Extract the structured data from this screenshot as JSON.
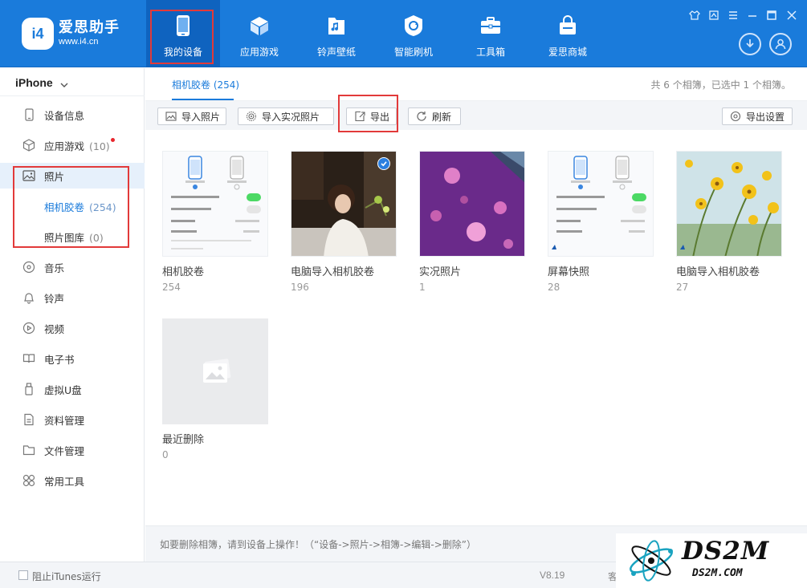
{
  "app": {
    "name": "爱思助手",
    "url": "www.i4.cn",
    "logo_text": "i4"
  },
  "nav": [
    {
      "label": "我的设备",
      "icon": "phone-icon"
    },
    {
      "label": "应用游戏",
      "icon": "cube-icon"
    },
    {
      "label": "铃声壁纸",
      "icon": "music-file-icon"
    },
    {
      "label": "智能刷机",
      "icon": "refresh-shield-icon"
    },
    {
      "label": "工具箱",
      "icon": "toolbox-icon"
    },
    {
      "label": "爱思商城",
      "icon": "shopping-bag-icon"
    }
  ],
  "window_controls": [
    "shirt-icon",
    "skin-icon",
    "menu-icon",
    "minimize-icon",
    "maximize-icon",
    "close-icon"
  ],
  "sidebar": {
    "device": "iPhone",
    "items": [
      {
        "label": "设备信息",
        "icon": "device-info-icon"
      },
      {
        "label": "应用游戏",
        "count": "(10)",
        "icon": "apps-icon"
      },
      {
        "label": "照片",
        "icon": "photo-icon"
      },
      {
        "label": "相机胶卷",
        "count": "(254)"
      },
      {
        "label": "照片图库",
        "count": "(0)"
      },
      {
        "label": "音乐",
        "icon": "music-icon"
      },
      {
        "label": "铃声",
        "icon": "bell-icon"
      },
      {
        "label": "视频",
        "icon": "video-icon"
      },
      {
        "label": "电子书",
        "icon": "ebook-icon"
      },
      {
        "label": "虚拟U盘",
        "icon": "usb-icon"
      },
      {
        "label": "资料管理",
        "icon": "data-icon"
      },
      {
        "label": "文件管理",
        "icon": "folder-icon"
      },
      {
        "label": "常用工具",
        "icon": "tools-icon"
      }
    ]
  },
  "tab": {
    "label": "相机胶卷 (254)"
  },
  "summary": "共 6 个相簿，已选中 1 个相簿。",
  "toolbar": {
    "import_photos": "导入照片",
    "import_live": "导入实况照片",
    "export": "导出",
    "refresh": "刷新",
    "export_settings": "导出设置"
  },
  "albums": [
    {
      "name": "相机胶卷",
      "count": "254"
    },
    {
      "name": "电脑导入相机胶卷",
      "count": "196",
      "selected": true
    },
    {
      "name": "实况照片",
      "count": "1"
    },
    {
      "name": "屏幕快照",
      "count": "28"
    },
    {
      "name": "电脑导入相机胶卷",
      "count": "27"
    },
    {
      "name": "最近删除",
      "count": "0"
    }
  ],
  "hint": "如要删除相簿，请到设备上操作！（“设备->照片->相簿->编辑->删除”）",
  "status": {
    "block_itunes": "阻止iTunes运行",
    "version": "V8.19",
    "cut_text": "客"
  },
  "watermark": {
    "big": "DS2M",
    "small": "DS2M.COM"
  },
  "colors": {
    "brand": "#1a7bdb",
    "highlight": "#e23a3a",
    "selected": "#2b7fe0"
  }
}
